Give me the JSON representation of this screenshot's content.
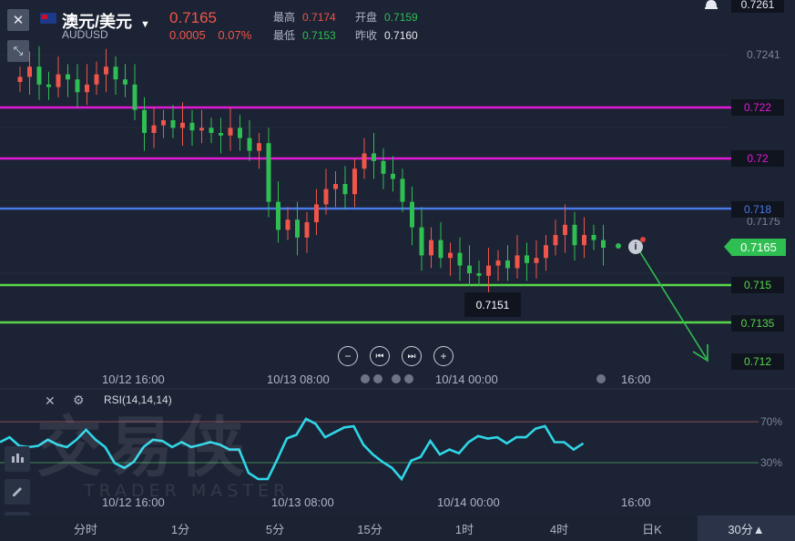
{
  "instrument": {
    "name": "澳元/美元",
    "code": "AUDUSD",
    "price": "0.7165",
    "change": "0.0005",
    "change_pct": "0.07%"
  },
  "stats": {
    "high_label": "最高",
    "high": "0.7174",
    "open_label": "开盘",
    "open": "0.7159",
    "low_label": "最低",
    "low": "0.7153",
    "prev_close_label": "昨收",
    "prev_close": "0.7160"
  },
  "axis": {
    "top_value": "0.7261",
    "ticks": [
      "0.7241",
      "0.7175"
    ],
    "current_price": "0.7165",
    "lows_label": "0.7151"
  },
  "levels": [
    {
      "value": "0.722",
      "color": "#e21ad7"
    },
    {
      "value": "0.72",
      "color": "#e21ad7"
    },
    {
      "value": "0.718",
      "color": "#4a79e8"
    },
    {
      "value": "0.715",
      "color": "#58d64b"
    },
    {
      "value": "0.7135",
      "color": "#58d64b"
    },
    {
      "value": "0.712",
      "color": "#58d64b"
    }
  ],
  "time_axis": [
    "10/12 16:00",
    "10/13 08:00",
    "10/14 00:00",
    "16:00"
  ],
  "rsi": {
    "label": "RSI(14,14,14)",
    "level_high": "70%",
    "level_low": "30%",
    "line_color": "#2ed6e8"
  },
  "rsi_time_axis": [
    "10/12 16:00",
    "10/13 08:00",
    "10/14 00:00",
    "16:00"
  ],
  "watermark": {
    "title": "交易侠",
    "subtitle": "TRADER MASTER"
  },
  "tabs": [
    "分时",
    "1分",
    "5分",
    "15分",
    "1时",
    "4时",
    "日K",
    "30分▲"
  ],
  "colors": {
    "up": "#f0554a",
    "down": "#2fbe52",
    "accent": "#2fbe52"
  },
  "chart_data": {
    "type": "candlestick",
    "series": [
      {
        "name": "AUDUSD 30分",
        "values": [
          0.7232,
          0.7236,
          0.7229,
          0.7228,
          0.7233,
          0.7231,
          0.7226,
          0.7229,
          0.7233,
          0.7236,
          0.7231,
          0.7229,
          0.7219,
          0.721,
          0.7213,
          0.7215,
          0.7212,
          0.7214,
          0.7211,
          0.7212,
          0.721,
          0.7209,
          0.7212,
          0.7208,
          0.7203,
          0.7206,
          0.7183,
          0.7172,
          0.7176,
          0.7169,
          0.7175,
          0.7182,
          0.7188,
          0.719,
          0.7186,
          0.7196,
          0.7202,
          0.7199,
          0.7194,
          0.7192,
          0.7183,
          0.7173,
          0.7162,
          0.7168,
          0.7161,
          0.7163,
          0.7158,
          0.7155,
          0.7154,
          0.7158,
          0.716,
          0.7157,
          0.7162,
          0.7159,
          0.7161,
          0.7166,
          0.717,
          0.7174,
          0.7166,
          0.717,
          0.7168,
          0.7165
        ]
      }
    ],
    "ylim": [
      0.711,
      0.7265
    ]
  }
}
